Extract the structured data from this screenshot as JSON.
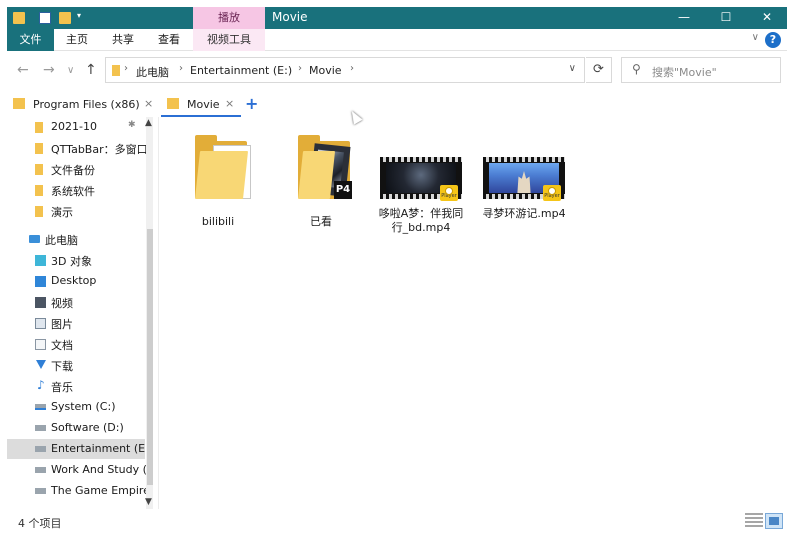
{
  "window": {
    "title": "Movie",
    "context_tab_label": "播放",
    "buttons": {
      "minimize": "—",
      "maximize": "☐",
      "close": "✕"
    }
  },
  "ribbon": {
    "tabs": [
      "文件",
      "主页",
      "共享",
      "查看",
      "视频工具"
    ],
    "collapse": "∨",
    "help": "?"
  },
  "address": {
    "back": "←",
    "forward": "→",
    "recent": "∨",
    "up": "↑",
    "crumbs": [
      "此电脑",
      "Entertainment (E:)",
      "Movie"
    ],
    "separator": "›",
    "dropdown": "∨",
    "refresh": "⟳",
    "search_placeholder": "搜索\"Movie\"",
    "search_icon": "⚲"
  },
  "tabs": {
    "items": [
      {
        "label": "Program Files (x86)",
        "close": "×"
      },
      {
        "label": "Movie",
        "close": "×"
      }
    ],
    "add": "+"
  },
  "nav": {
    "quick_access": [
      {
        "label": "2021-10",
        "icon": "folder-icon",
        "pinned": true
      },
      {
        "label": "QTTabBar：多窗口",
        "icon": "folder-icon"
      },
      {
        "label": "文件备份",
        "icon": "folder-icon"
      },
      {
        "label": "系统软件",
        "icon": "folder-icon"
      },
      {
        "label": "演示",
        "icon": "folder-icon"
      }
    ],
    "pin_glyph": "✱",
    "this_pc": "此电脑",
    "pc_items": [
      {
        "label": "3D 对象",
        "icon": "cube-icon"
      },
      {
        "label": "Desktop",
        "icon": "desktop-icon"
      },
      {
        "label": "视频",
        "icon": "video-icon"
      },
      {
        "label": "图片",
        "icon": "picture-icon"
      },
      {
        "label": "文档",
        "icon": "document-icon"
      },
      {
        "label": "下载",
        "icon": "download-icon"
      },
      {
        "label": "音乐",
        "icon": "music-icon"
      },
      {
        "label": "System (C:)",
        "icon": "drive-icon"
      },
      {
        "label": "Software (D:)",
        "icon": "drive-icon"
      },
      {
        "label": "Entertainment (E:)",
        "icon": "drive-icon",
        "selected": true
      },
      {
        "label": "Work And Study (",
        "icon": "drive-icon"
      },
      {
        "label": "The Game Empire",
        "icon": "drive-icon"
      }
    ],
    "scroll_up": "▲",
    "scroll_down": "▼"
  },
  "files": [
    {
      "name": "bilibili",
      "type": "folder"
    },
    {
      "name": "已看",
      "type": "folder",
      "badge": "P4"
    },
    {
      "name_line1": "哆啦A梦：伴我同",
      "name_line2": "行_bd.mp4",
      "type": "video"
    },
    {
      "name": "寻梦环游记.mp4",
      "type": "video"
    }
  ],
  "player_badge": "Player",
  "status": {
    "count": "4 个项目"
  },
  "colors": {
    "titlebar": "#19717c",
    "context_tab": "#f6c6e4",
    "folder": "#f3c24e",
    "accent": "#2b6fd4",
    "selection": "#dcdcdc"
  }
}
